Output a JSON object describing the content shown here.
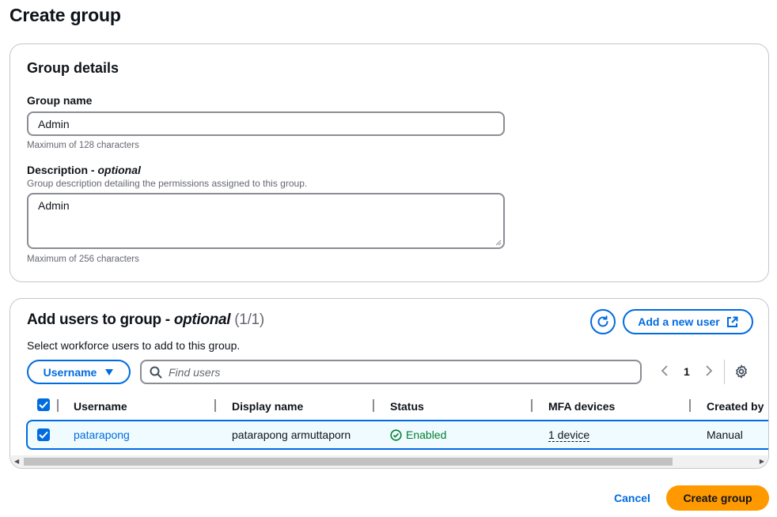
{
  "page": {
    "title": "Create group"
  },
  "details": {
    "section_title": "Group details",
    "group_name": {
      "label": "Group name",
      "value": "Admin",
      "constraint": "Maximum of 128 characters"
    },
    "description": {
      "label": "Description - ",
      "label_optional": "optional",
      "hint": "Group description detailing the permissions assigned to this group.",
      "value": "Admin",
      "constraint": "Maximum of 256 characters"
    }
  },
  "users": {
    "title": "Add users to group - ",
    "title_optional": "optional",
    "count": "(1/1)",
    "subtitle": "Select workforce users to add to this group.",
    "add_user_label": "Add a new user",
    "filter_label": "Username",
    "search_placeholder": "Find users",
    "page_number": "1",
    "columns": [
      "Username",
      "Display name",
      "Status",
      "MFA devices",
      "Created by"
    ],
    "rows": [
      {
        "username": "patarapong",
        "display_name": "patarapong armuttaporn",
        "status": "Enabled",
        "mfa": "1 device",
        "created_by": "Manual",
        "selected": true
      }
    ]
  },
  "footer": {
    "cancel_label": "Cancel",
    "create_label": "Create group"
  },
  "colors": {
    "accent": "#006ce0",
    "primary_button": "#ff9900",
    "status_enabled": "#00802f",
    "selected_row_bg": "#f0fbff"
  },
  "icons": [
    "refresh-icon",
    "external-link-icon",
    "caret-down-icon",
    "search-icon",
    "chevron-left-icon",
    "chevron-right-icon",
    "settings-icon",
    "checkbox-checked-icon",
    "status-success-icon"
  ]
}
